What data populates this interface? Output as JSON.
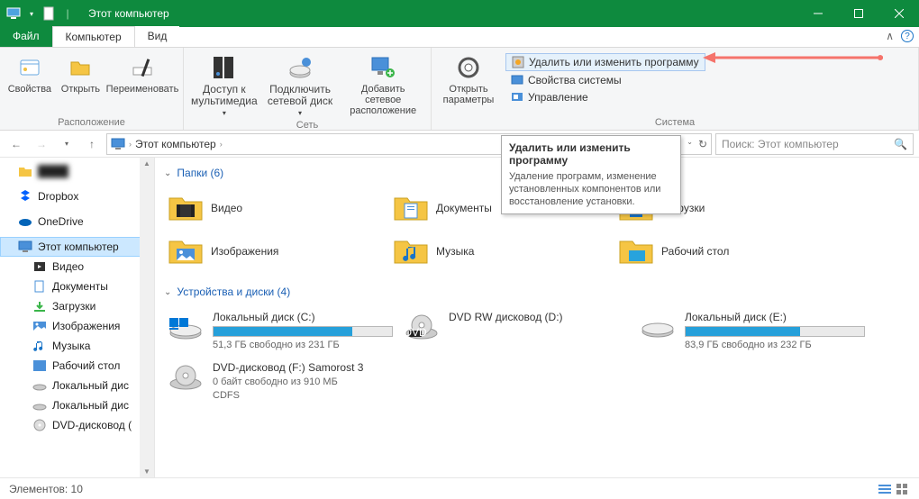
{
  "window": {
    "title": "Этот компьютер"
  },
  "tabs": {
    "file": "Файл",
    "computer": "Компьютер",
    "view": "Вид"
  },
  "ribbon": {
    "groups": {
      "location": {
        "label": "Расположение",
        "properties": "Свойства",
        "open": "Открыть",
        "rename": "Переименовать"
      },
      "network": {
        "label": "Сеть",
        "media": "Доступ к\nмультимедиа",
        "mapdrive": "Подключить\nсетевой диск",
        "addnet": "Добавить сетевое\nрасположение"
      },
      "system": {
        "label": "Система",
        "settings": "Открыть\nпараметры",
        "uninstall": "Удалить или изменить программу",
        "sysprops": "Свойства системы",
        "manage": "Управление"
      }
    }
  },
  "address": {
    "location": "Этот компьютер",
    "search_placeholder": "Поиск: Этот компьютер"
  },
  "tooltip": {
    "title": "Удалить или изменить программу",
    "body": "Удаление программ, изменение установленных компонентов или восстановление установки."
  },
  "sidebar": {
    "items": [
      {
        "id": "blurred",
        "label": ""
      },
      {
        "id": "dropbox",
        "label": "Dropbox"
      },
      {
        "id": "onedrive",
        "label": "OneDrive"
      },
      {
        "id": "thispc",
        "label": "Этот компьютер",
        "selected": true
      },
      {
        "id": "videos",
        "label": "Видео"
      },
      {
        "id": "documents",
        "label": "Документы"
      },
      {
        "id": "downloads",
        "label": "Загрузки"
      },
      {
        "id": "pictures",
        "label": "Изображения"
      },
      {
        "id": "music",
        "label": "Музыка"
      },
      {
        "id": "desktop",
        "label": "Рабочий стол"
      },
      {
        "id": "localc",
        "label": "Локальный дис"
      },
      {
        "id": "locale",
        "label": "Локальный дис"
      },
      {
        "id": "dvdf",
        "label": "DVD-дисковод ("
      }
    ]
  },
  "content": {
    "folders_header": "Папки (6)",
    "folders": [
      {
        "id": "videos",
        "label": "Видео"
      },
      {
        "id": "documents",
        "label": "Документы"
      },
      {
        "id": "downloads",
        "label": "Загрузки"
      },
      {
        "id": "pictures",
        "label": "Изображения"
      },
      {
        "id": "music",
        "label": "Музыка"
      },
      {
        "id": "desktop",
        "label": "Рабочий стол"
      }
    ],
    "drives_header": "Устройства и диски (4)",
    "drives": [
      {
        "id": "c",
        "label": "Локальный диск (C:)",
        "sub": "51,3 ГБ свободно из 231 ГБ",
        "fill": 78
      },
      {
        "id": "dvd-d",
        "label": "DVD RW дисковод (D:)",
        "bar": false
      },
      {
        "id": "e",
        "label": "Локальный диск (E:)",
        "sub": "83,9 ГБ свободно из 232 ГБ",
        "fill": 64
      },
      {
        "id": "dvd-f",
        "label": "DVD-дисковод (F:) Samorost 3",
        "sub": "0 байт свободно из 910 МБ",
        "sub2": "CDFS",
        "bar": false
      }
    ]
  },
  "statusbar": {
    "text": "Элементов: 10"
  }
}
